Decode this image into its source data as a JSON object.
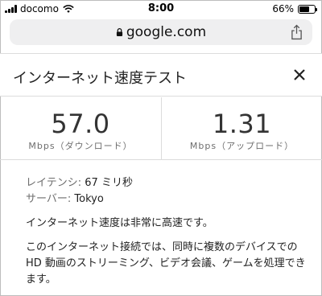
{
  "status_bar": {
    "carrier": "docomo",
    "time": "8:00",
    "battery_percent": "66%",
    "battery_level": 0.66
  },
  "url_bar": {
    "url": "google.com",
    "lock_icon": "lock-icon",
    "share_icon": "share-icon"
  },
  "card": {
    "title": "インターネット速度テスト",
    "close_icon": "close-icon",
    "download": {
      "value": "57.0",
      "unit": "Mbps（ダウンロード）"
    },
    "upload": {
      "value": "1.31",
      "unit": "Mbps（アップロード）"
    },
    "latency_label": "レイテンシ: ",
    "latency_value": "67 ミリ秒",
    "server_label": "サーバー: ",
    "server_value": "Tokyo",
    "message": "インターネット速度は非常に高速です。",
    "description": "このインターネット接続では、同時に複数のデバイスでの HD 動画のストリーミング、ビデオ会議、ゲームを処理できます。"
  }
}
